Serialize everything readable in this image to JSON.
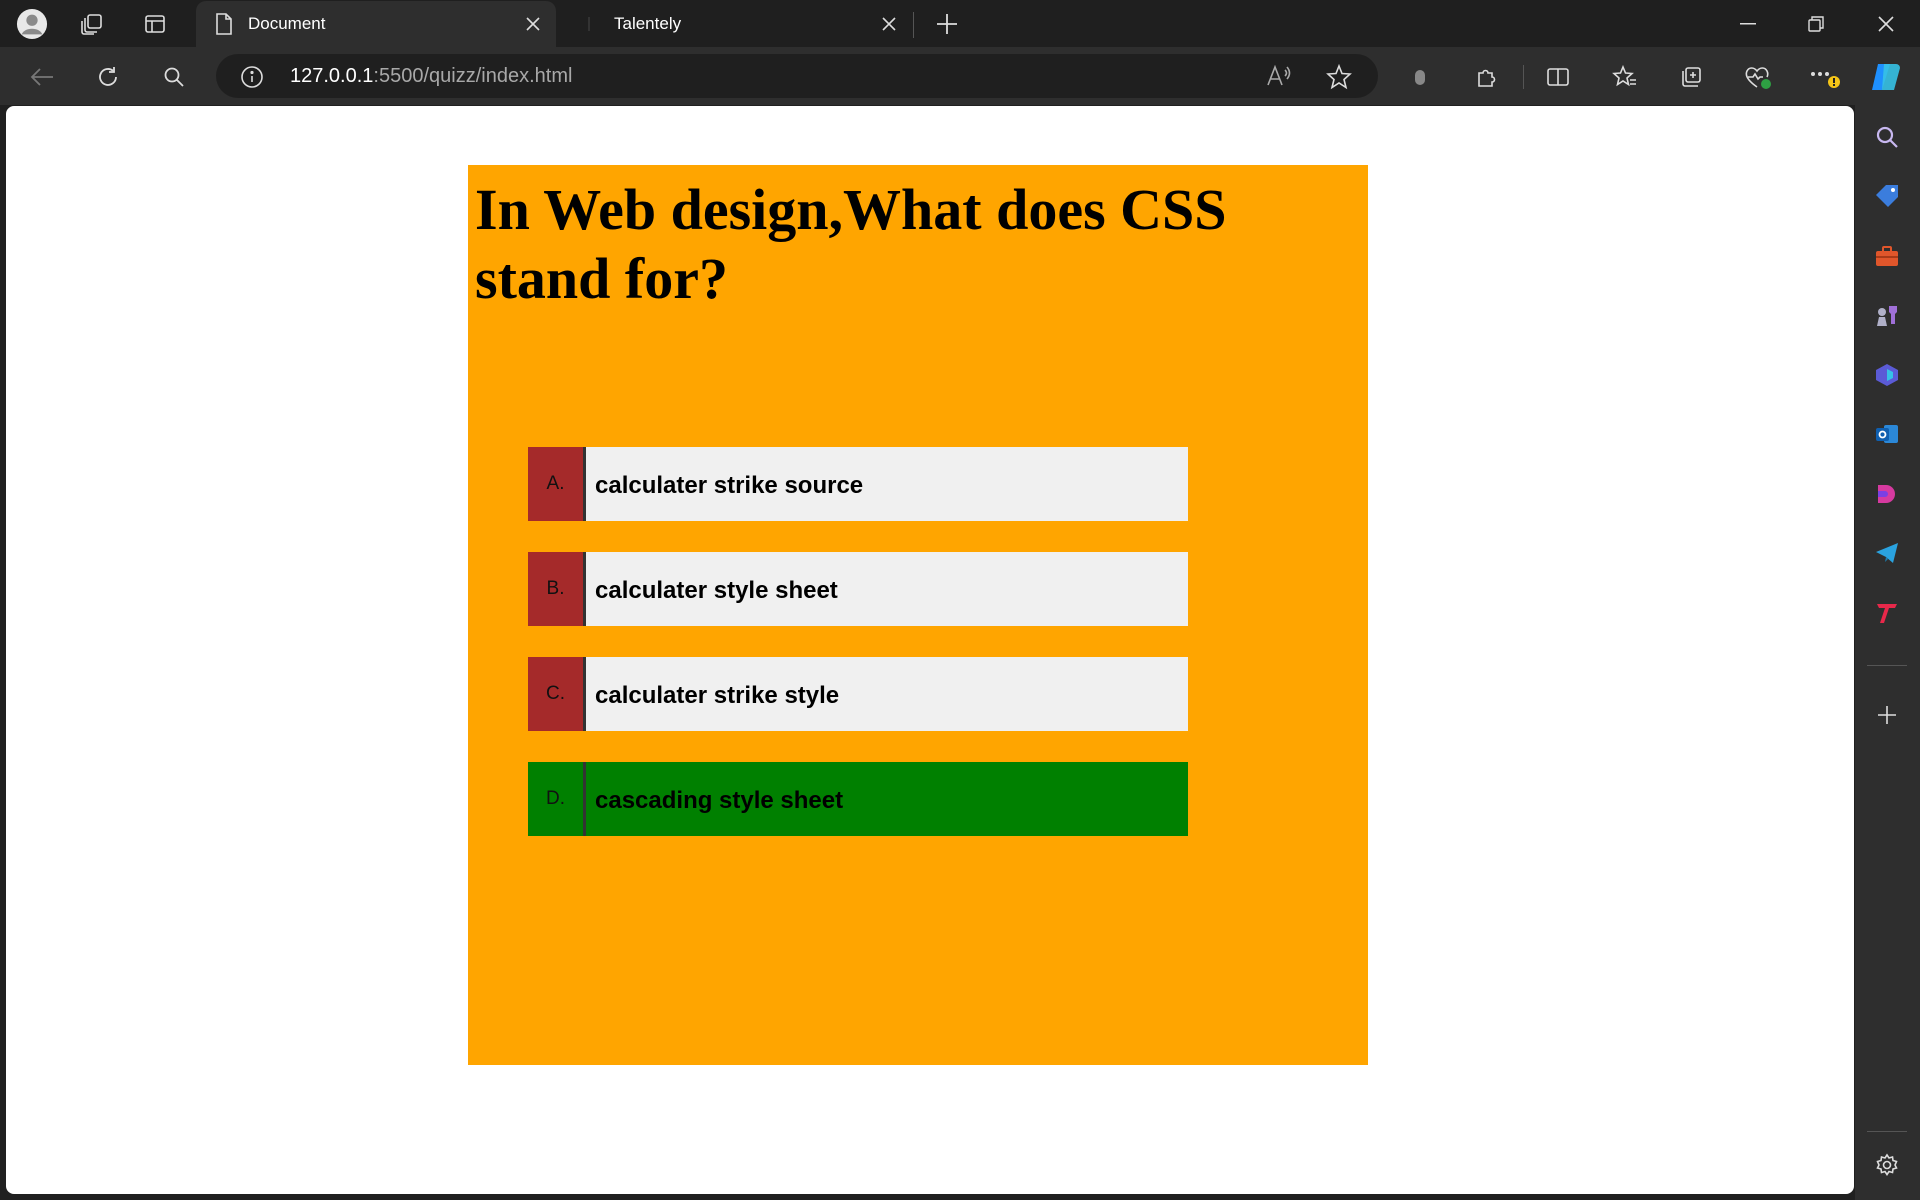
{
  "browser": {
    "tabs": [
      {
        "title": "Document",
        "active": true
      },
      {
        "title": "Talentely",
        "active": false
      }
    ],
    "url": {
      "host": "127.0.0.1",
      "rest": ":5500/quizz/index.html"
    }
  },
  "quiz": {
    "question": "In Web design,What does CSS stand for?",
    "options": [
      {
        "letter": "A.",
        "text": "calculater strike source",
        "state": "default"
      },
      {
        "letter": "B.",
        "text": "calculater style sheet",
        "state": "default"
      },
      {
        "letter": "C.",
        "text": "calculater strike style",
        "state": "default"
      },
      {
        "letter": "D.",
        "text": "cascading style sheet",
        "state": "correct"
      }
    ]
  },
  "colors": {
    "quiz_bg": "#ffa500",
    "option_bg": "#f0f0f0",
    "letter_bg": "#a52a2a",
    "correct_bg": "#008000"
  }
}
